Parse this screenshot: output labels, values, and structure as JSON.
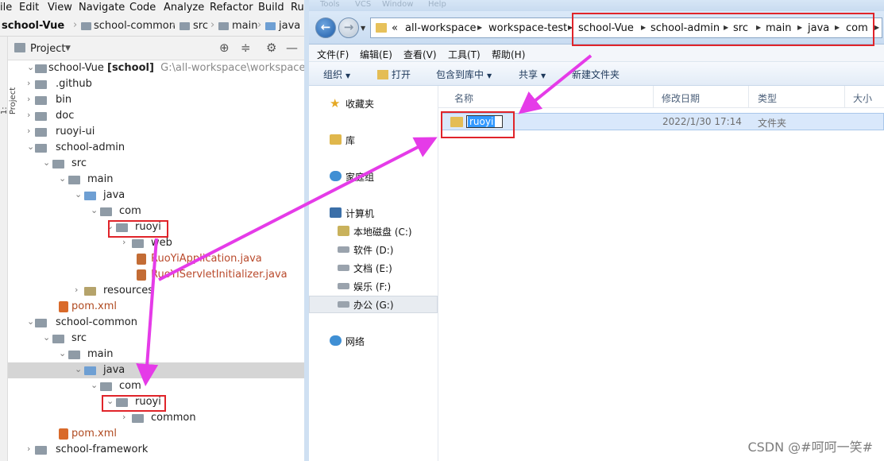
{
  "ide": {
    "menu": [
      "ile",
      "Edit",
      "View",
      "Navigate",
      "Code",
      "Analyze",
      "Refactor",
      "Build",
      "Ru"
    ],
    "navbar": [
      "school-Vue",
      "school-common",
      "src",
      "main",
      "java"
    ],
    "tool_window_label": "1: Project",
    "panel_title": "Project",
    "tree": [
      {
        "label": "school-Vue",
        "bold": "[school]",
        "path": "G:\\all-workspace\\workspace-test\\sc"
      },
      {
        "label": ".github"
      },
      {
        "label": "bin"
      },
      {
        "label": "doc"
      },
      {
        "label": "ruoyi-ui"
      },
      {
        "label": "school-admin"
      },
      {
        "label": "src"
      },
      {
        "label": "main"
      },
      {
        "label": "java"
      },
      {
        "label": "com"
      },
      {
        "label": "ruoyi"
      },
      {
        "label": "web"
      },
      {
        "label": "RuoYiApplication.java"
      },
      {
        "label": "RuoYiServletInitializer.java"
      },
      {
        "label": "resources"
      },
      {
        "label": "pom.xml"
      },
      {
        "label": "school-common"
      },
      {
        "label": "src"
      },
      {
        "label": "main"
      },
      {
        "label": "java"
      },
      {
        "label": "com"
      },
      {
        "label": "ruoyi"
      },
      {
        "label": "common"
      },
      {
        "label": "pom.xml"
      },
      {
        "label": "school-framework"
      }
    ]
  },
  "explorer": {
    "titlebar": [
      "Tools",
      "VCS",
      "Window",
      "Help"
    ],
    "address": [
      "«",
      "all-workspace",
      "workspace-test",
      "school-Vue",
      "school-admin",
      "src",
      "main",
      "java",
      "com"
    ],
    "menu": [
      "文件(F)",
      "编辑(E)",
      "查看(V)",
      "工具(T)",
      "帮助(H)"
    ],
    "toolbar": [
      "组织",
      "打开",
      "包含到库中",
      "共享",
      "新建文件夹"
    ],
    "nav": [
      "收藏夹",
      "库",
      "家庭组",
      "计算机",
      "本地磁盘 (C:)",
      "软件 (D:)",
      "文档 (E:)",
      "娱乐 (F:)",
      "办公 (G:)",
      "网络"
    ],
    "columns": [
      "名称",
      "修改日期",
      "类型",
      "大小"
    ],
    "file": {
      "name": "ruoyi",
      "modified": "2022/1/30 17:14",
      "type": "文件夹"
    }
  },
  "colors": {
    "annotation_red": "#e0242a",
    "arrow_magenta": "#e53be8",
    "rename_highlight": "#3399ff"
  },
  "watermark": "CSDN @#呵呵一笑#"
}
